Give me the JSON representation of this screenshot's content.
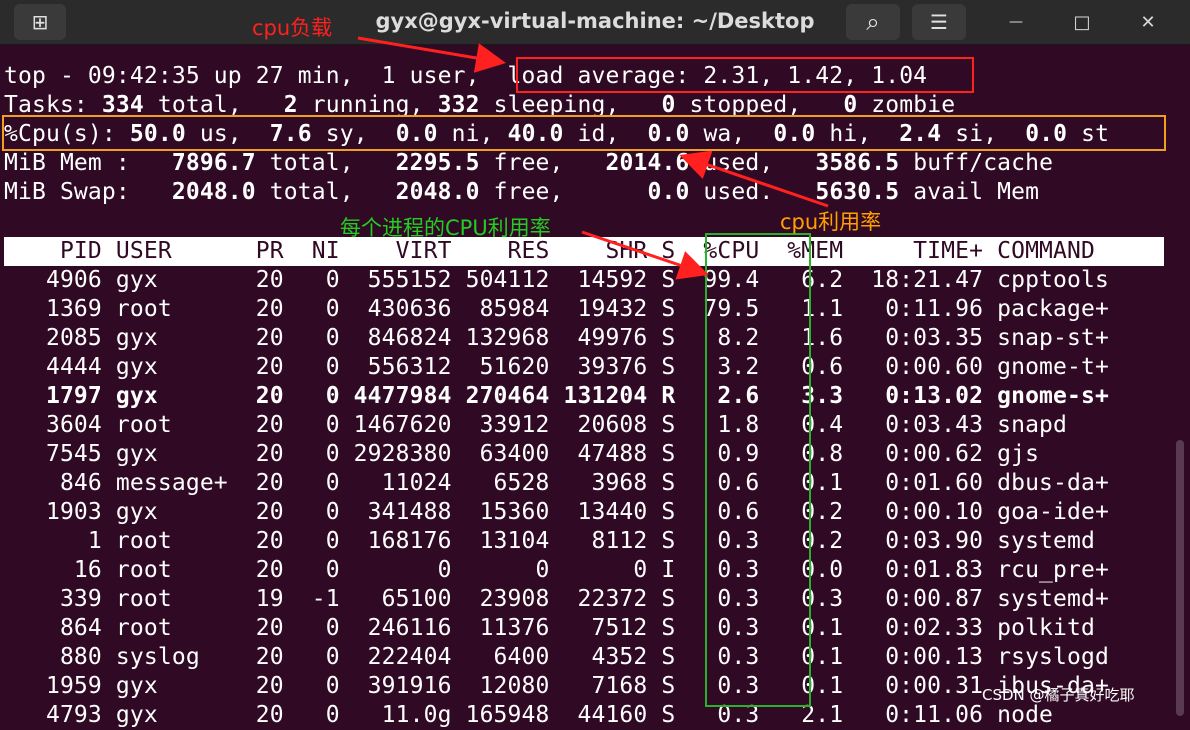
{
  "window": {
    "title": "gyx@gyx-virtual-machine: ~/Desktop",
    "new_tab_glyph": "⊞",
    "search_glyph": "⌕",
    "menu_glyph": "☰",
    "minimize_glyph": "—",
    "maximize_glyph": "□",
    "close_glyph": "✕",
    "icons": [
      "new-tab-icon",
      "search-icon",
      "hamburger-menu-icon",
      "minimize-icon",
      "maximize-icon",
      "close-icon"
    ]
  },
  "summary": {
    "line1_a": "top - 09:42:35 up 27 min,  1 user,  ",
    "line1_b": "load average: 2.31, 1.42, 1.04",
    "tasks": {
      "label": "Tasks: ",
      "total": "334",
      "t1": " total,   ",
      "running": "2",
      "t2": " running, ",
      "sleeping": "332",
      "t3": " sleeping,   ",
      "stopped": "0",
      "t4": " stopped,   ",
      "zombie": "0",
      "t5": " zombie"
    },
    "cpu": {
      "label": "%Cpu(s): ",
      "us": "50.0",
      "a": " us,  ",
      "sy": "7.6",
      "b": " sy,  ",
      "ni": "0.0",
      "c": " ni, ",
      "id": "40.0",
      "d": " id,  ",
      "wa": "0.0",
      "e": " wa,  ",
      "hi": "0.0",
      "f": " hi,  ",
      "si": "2.4",
      "g": " si,  ",
      "st": "0.0",
      "h": " st"
    },
    "mem": {
      "label": "MiB Mem :   ",
      "total": "7896.7",
      "a": " total,   ",
      "free": "2295.5",
      "b": " free,   ",
      "used": "2014.6",
      "c": " used,   ",
      "buff": "3586.5",
      "d": " buff/cache"
    },
    "swap": {
      "label": "MiB Swap:   ",
      "total": "2048.0",
      "a": " total,   ",
      "free": "2048.0",
      "b": " free,      ",
      "used": "0.0",
      "c": " used.   ",
      "avail": "5630.5",
      "d": " avail Mem"
    }
  },
  "table": {
    "header": "    PID USER      PR  NI    VIRT    RES    SHR S  %CPU  %MEM     TIME+ COMMAND",
    "rows": [
      "   4906 gyx       20   0  555152 504112  14592 S  99.4   6.2  18:21.47 cpptools",
      "   1369 root      20   0  430636  85984  19432 S  79.5   1.1   0:11.96 package+",
      "   2085 gyx       20   0  846824 132968  49976 S   8.2   1.6   0:03.35 snap-st+",
      "   4444 gyx       20   0  556312  51620  39376 S   3.2   0.6   0:00.60 gnome-t+",
      "   1797 gyx       20   0 4477984 270464 131204 R   2.6   3.3   0:13.02 gnome-s+",
      "   3604 root      20   0 1467620  33912  20608 S   1.8   0.4   0:03.43 snapd",
      "   7545 gyx       20   0 2928380  63400  47488 S   0.9   0.8   0:00.62 gjs",
      "    846 message+  20   0   11024   6528   3968 S   0.6   0.1   0:01.60 dbus-da+",
      "   1903 gyx       20   0  341488  15360  13440 S   0.6   0.2   0:00.10 goa-ide+",
      "      1 root      20   0  168176  13104   8112 S   0.3   0.2   0:03.90 systemd",
      "     16 root      20   0       0      0      0 I   0.3   0.0   0:01.83 rcu_pre+",
      "    339 root      19  -1   65100  23908  22372 S   0.3   0.3   0:00.87 systemd+",
      "    864 root      20   0  246116  11376   7512 S   0.3   0.1   0:02.33 polkitd",
      "    880 syslog    20   0  222404   6400   4352 S   0.3   0.1   0:00.13 rsyslogd",
      "   1959 gyx       20   0  391916  12080   7168 S   0.3   0.1   0:00.31 ibus-da+",
      "   4793 gyx       20   0   11.0g 165948  44160 S   0.3   2.1   0:11.06 node"
    ]
  },
  "annotations": {
    "load": "cpu负载",
    "cpu_usage": "cpu利用率",
    "per_process": "每个进程的CPU利用率",
    "colors": {
      "red": "#ff2020",
      "orange": "#ffa000",
      "green": "#22cc22"
    }
  },
  "watermark": "CSDN @橘子真好吃耶"
}
